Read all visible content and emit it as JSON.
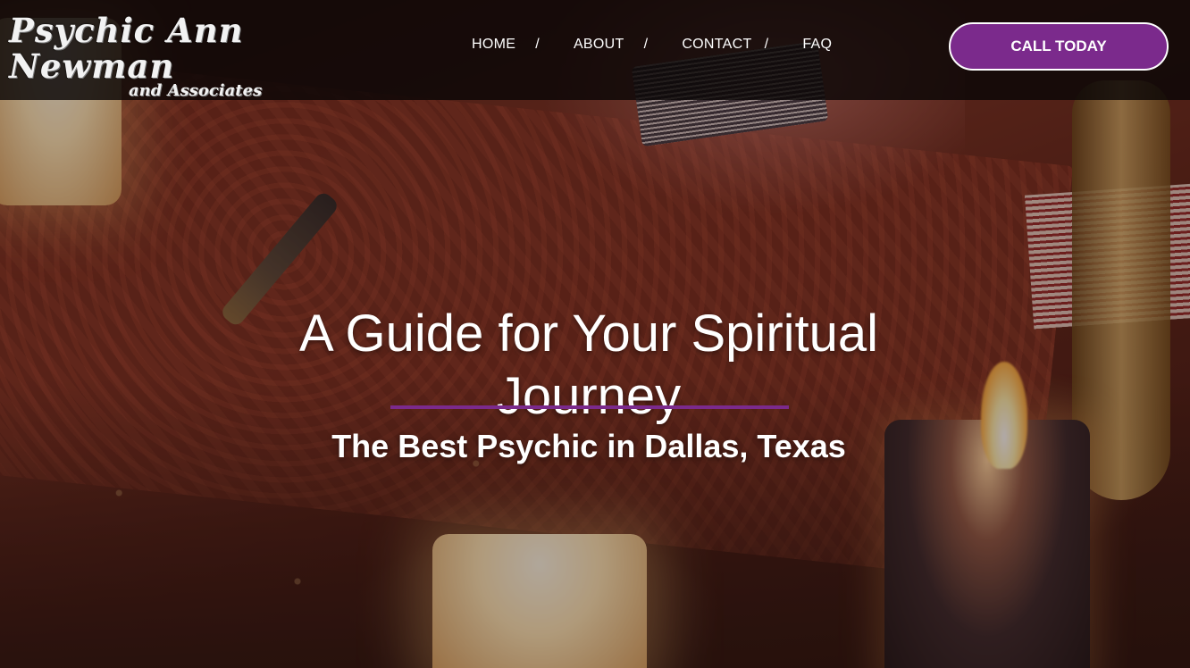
{
  "logo": {
    "line1": "Psychic Ann Newman",
    "line2": "and Associates"
  },
  "nav": {
    "items": [
      "HOME",
      "ABOUT",
      "CONTACT",
      "FAQ"
    ],
    "separator": "/"
  },
  "cta": {
    "label": "CALL TODAY",
    "color": "#7b2a8c"
  },
  "hero": {
    "headline": "A Guide for Your Spiritual Journey",
    "subheadline": "The Best Psychic in Dallas, Texas",
    "accent_color": "#7b2a8c"
  }
}
